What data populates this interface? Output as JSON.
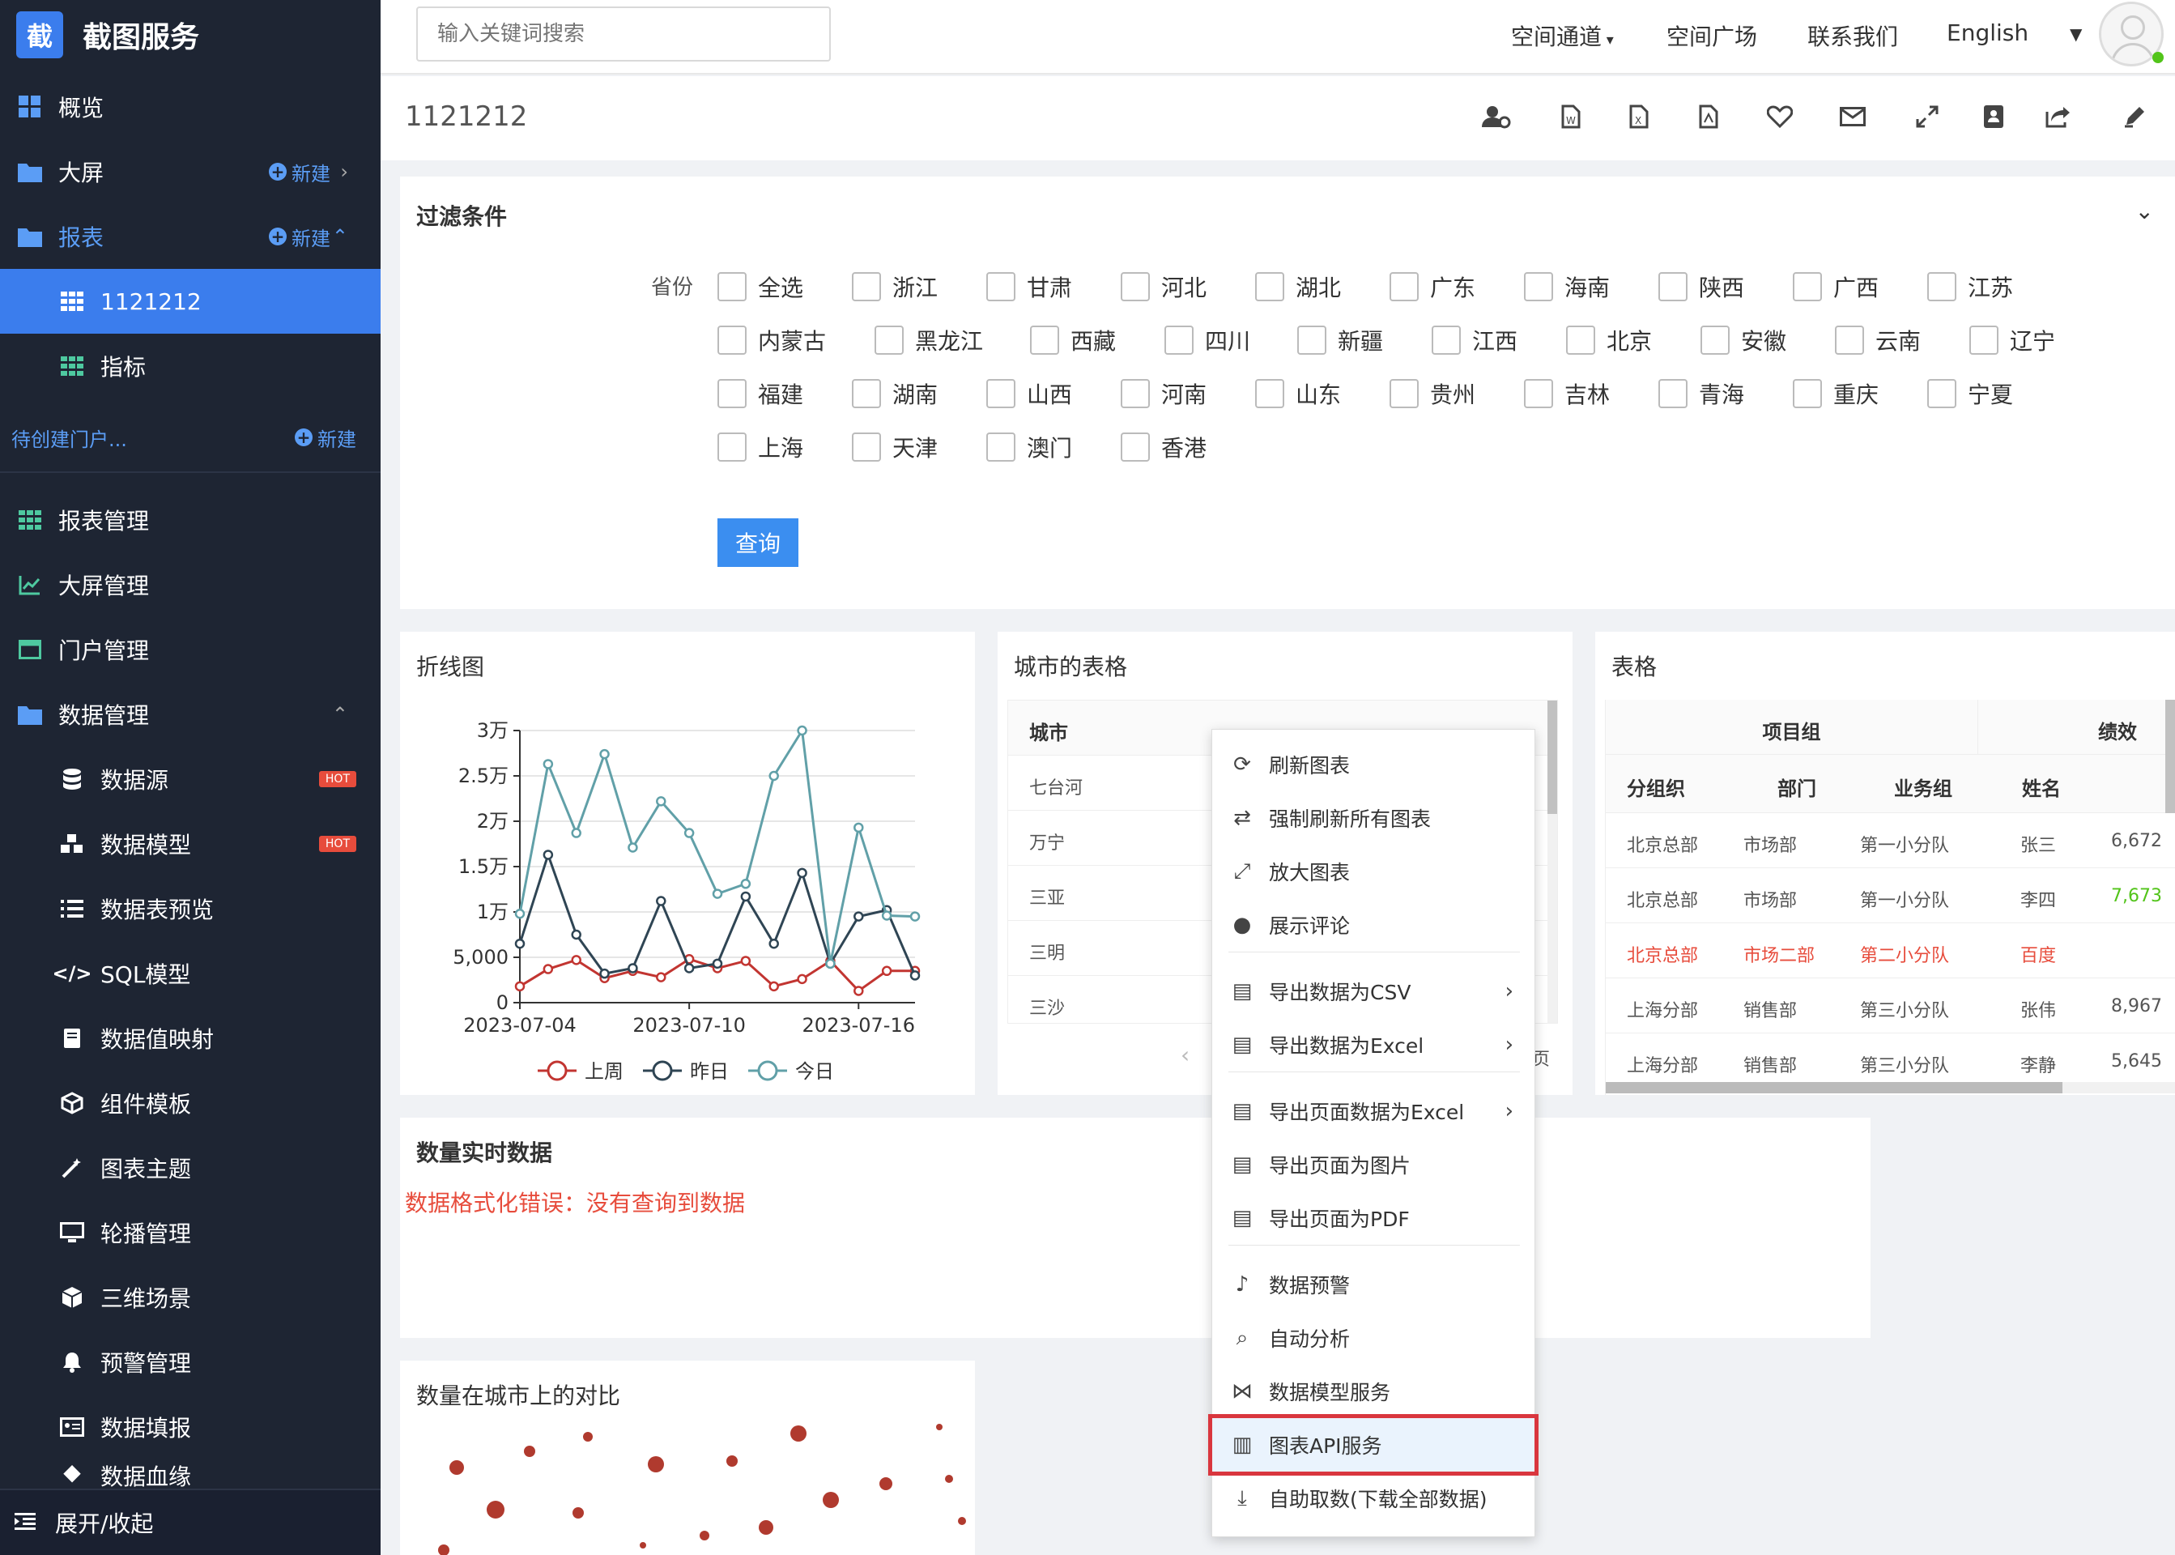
{
  "brand": {
    "logo_char": "截",
    "name": "截图服务"
  },
  "sidebar": {
    "items": [
      {
        "label": "概览"
      },
      {
        "label": "大屏",
        "new": "新建"
      },
      {
        "label": "报表",
        "new": "新建"
      },
      {
        "label": "1121212"
      },
      {
        "label": "指标"
      },
      {
        "label": "待创建门户...",
        "new": "新建"
      },
      {
        "label": "报表管理"
      },
      {
        "label": "大屏管理"
      },
      {
        "label": "门户管理"
      },
      {
        "label": "数据管理"
      },
      {
        "label": "数据源",
        "badge": "HOT"
      },
      {
        "label": "数据模型",
        "badge": "HOT"
      },
      {
        "label": "数据表预览"
      },
      {
        "label": "SQL模型"
      },
      {
        "label": "数据值映射"
      },
      {
        "label": "组件模板"
      },
      {
        "label": "图表主题"
      },
      {
        "label": "轮播管理"
      },
      {
        "label": "三维场景"
      },
      {
        "label": "预警管理"
      },
      {
        "label": "数据填报"
      },
      {
        "label": "数据血缘"
      }
    ],
    "footer": "展开/收起"
  },
  "header": {
    "search_placeholder": "输入关键词搜索",
    "nav": [
      "空间通道",
      "空间广场",
      "联系我们",
      "English"
    ]
  },
  "page": {
    "title": "1121212"
  },
  "filter": {
    "title": "过滤条件",
    "label": "省份",
    "options": [
      "全选",
      "浙江",
      "甘肃",
      "河北",
      "湖北",
      "广东",
      "海南",
      "陕西",
      "广西",
      "江苏",
      "内蒙古",
      "黑龙江",
      "西藏",
      "四川",
      "新疆",
      "江西",
      "北京",
      "安徽",
      "云南",
      "辽宁",
      "福建",
      "湖南",
      "山西",
      "河南",
      "山东",
      "贵州",
      "吉林",
      "青海",
      "重庆",
      "宁夏",
      "上海",
      "天津",
      "澳门",
      "香港"
    ],
    "query_label": "查询"
  },
  "line_panel": {
    "title": "折线图"
  },
  "chart_data": {
    "type": "line",
    "x": [
      "2023-07-04",
      "2023-07-05",
      "2023-07-06",
      "2023-07-07",
      "2023-07-08",
      "2023-07-09",
      "2023-07-10",
      "2023-07-11",
      "2023-07-12",
      "2023-07-13",
      "2023-07-14",
      "2023-07-15",
      "2023-07-16",
      "2023-07-17",
      "2023-07-18"
    ],
    "x_tick_labels": [
      "2023-07-04",
      "2023-07-10",
      "2023-07-16"
    ],
    "y_tick_labels": [
      "0",
      "5,000",
      "1万",
      "1.5万",
      "2万",
      "2.5万",
      "3万"
    ],
    "ylim": [
      0,
      30000
    ],
    "series": [
      {
        "name": "上周",
        "color": "#c23531",
        "values": [
          1800,
          3700,
          4700,
          2700,
          3500,
          2800,
          4800,
          3800,
          4600,
          1800,
          2600,
          4600,
          1300,
          3500,
          3500
        ]
      },
      {
        "name": "昨日",
        "color": "#2f4554",
        "values": [
          6500,
          16300,
          7500,
          3200,
          3800,
          11200,
          3800,
          4300,
          11700,
          6500,
          14300,
          4300,
          9500,
          10200,
          3000
        ]
      },
      {
        "name": "今日",
        "color": "#61a0a8",
        "values": [
          9800,
          26300,
          18700,
          27400,
          17100,
          22200,
          18700,
          12000,
          13100,
          25000,
          30000,
          4300,
          19300,
          9600,
          9500
        ]
      }
    ]
  },
  "city_table": {
    "title": "城市的表格",
    "header": "城市",
    "rows": [
      "七台河",
      "万宁",
      "三亚",
      "三明",
      "三沙"
    ],
    "pager_tail": "页"
  },
  "table_panel": {
    "title": "表格",
    "group_headers": [
      "项目组",
      "绩效"
    ],
    "headers": [
      "分组织",
      "部门",
      "业务组",
      "姓名"
    ],
    "rows": [
      {
        "org": "北京总部",
        "dept": "市场部",
        "team": "第一小分队",
        "name": "张三",
        "perf": "6,672",
        "highlight": false
      },
      {
        "org": "北京总部",
        "dept": "市场部",
        "team": "第一小分队",
        "name": "李四",
        "perf": "7,673",
        "highlight": false
      },
      {
        "org": "北京总部",
        "dept": "市场二部",
        "team": "第二小分队",
        "name": "百度",
        "perf": "",
        "highlight": true
      },
      {
        "org": "上海分部",
        "dept": "销售部",
        "team": "第三小分队",
        "name": "张伟",
        "perf": "8,967",
        "highlight": false
      },
      {
        "org": "上海分部",
        "dept": "销售部",
        "team": "第三小分队",
        "name": "李静",
        "perf": "5,645",
        "highlight": false
      }
    ]
  },
  "realtime_panel": {
    "title": "数量实时数据",
    "error": "数据格式化错误：没有查询到数据"
  },
  "scatter_panel": {
    "title": "数量在城市上的对比"
  },
  "context_menu": {
    "items": [
      {
        "label": "刷新图表",
        "icon": "refresh-icon"
      },
      {
        "label": "强制刷新所有图表",
        "icon": "sync-icon"
      },
      {
        "label": "放大图表",
        "icon": "expand-icon"
      },
      {
        "label": "展示评论",
        "icon": "comment-icon"
      },
      {
        "label": "导出数据为CSV",
        "icon": "file-csv-icon",
        "arrow": true
      },
      {
        "label": "导出数据为Excel",
        "icon": "file-excel-icon",
        "arrow": true
      },
      {
        "label": "导出页面数据为Excel",
        "icon": "file-excel-icon",
        "arrow": true
      },
      {
        "label": "导出页面为图片",
        "icon": "file-image-icon"
      },
      {
        "label": "导出页面为PDF",
        "icon": "file-pdf-icon"
      },
      {
        "label": "数据预警",
        "icon": "bell-icon"
      },
      {
        "label": "自动分析",
        "icon": "search-icon"
      },
      {
        "label": "数据模型服务",
        "icon": "nodes-icon"
      },
      {
        "label": "图表API服务",
        "icon": "bar-chart-icon"
      },
      {
        "label": "自助取数(下载全部数据)",
        "icon": "download-icon"
      }
    ]
  }
}
